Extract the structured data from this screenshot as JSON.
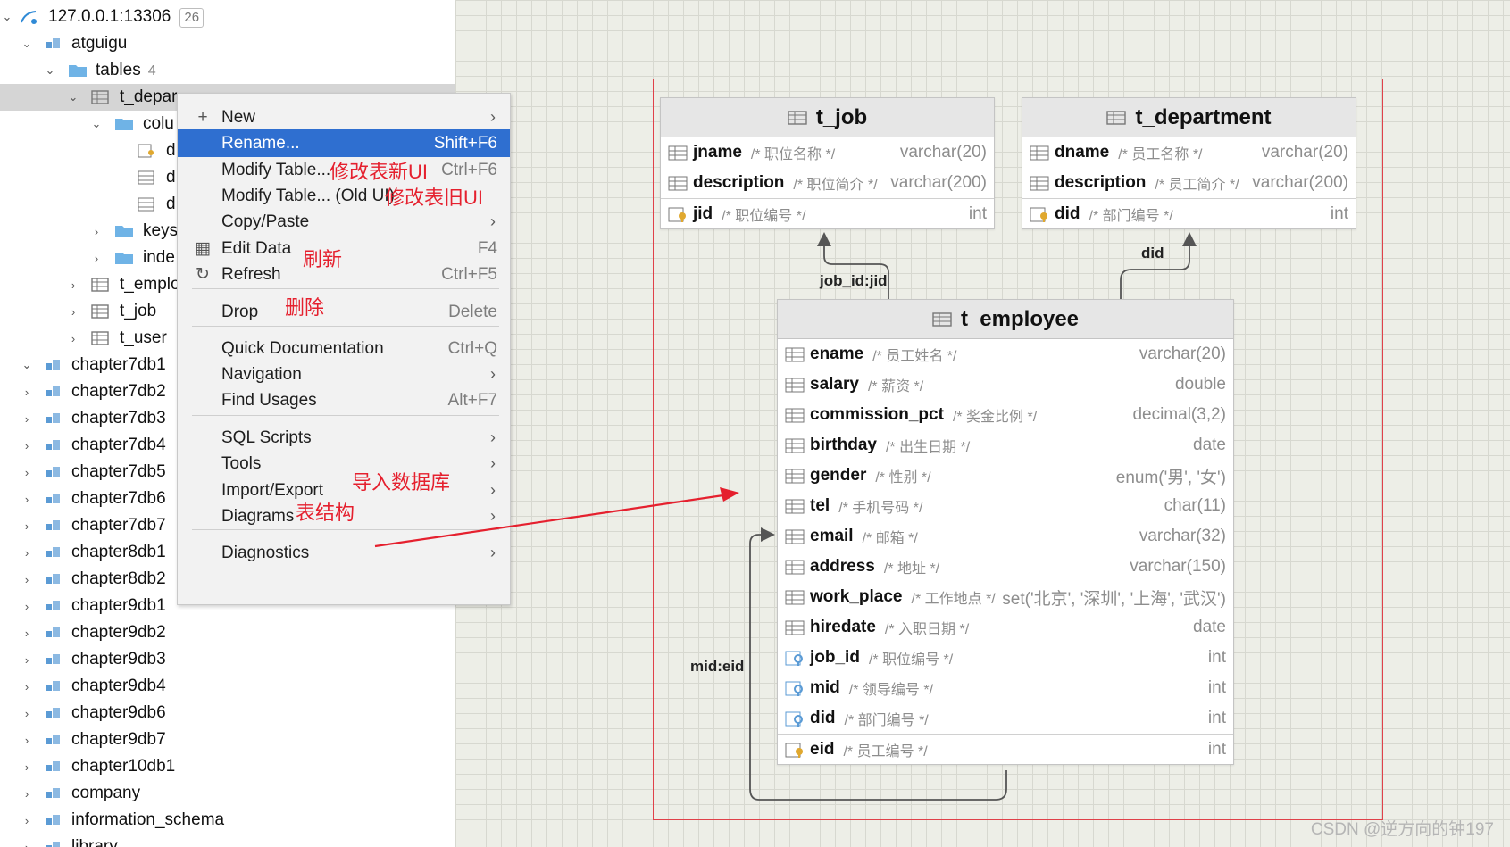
{
  "tree": {
    "connection": {
      "label": "127.0.0.1:13306",
      "badge": "26"
    },
    "schema": "atguigu",
    "tables_label": "tables",
    "tables_count": "4",
    "selected_table": "t_depar",
    "columns_label": "colu",
    "column_items": [
      "d",
      "d",
      "d"
    ],
    "keys_label": "keys",
    "indexes_label": "inde",
    "other_tables": [
      "t_emplo",
      "t_job",
      "t_user"
    ],
    "databases": [
      "chapter7db1",
      "chapter7db2",
      "chapter7db3",
      "chapter7db4",
      "chapter7db5",
      "chapter7db6",
      "chapter7db7",
      "chapter8db1",
      "chapter8db2",
      "chapter9db1",
      "chapter9db2",
      "chapter9db3",
      "chapter9db4",
      "chapter9db6",
      "chapter9db7",
      "chapter10db1",
      "company",
      "information_schema",
      "library"
    ]
  },
  "menu": {
    "items": [
      {
        "label": "New",
        "shortcut": "",
        "submenu": true
      },
      {
        "label": "Rename...",
        "shortcut": "Shift+F6",
        "submenu": false
      },
      {
        "label": "Modify Table...",
        "shortcut": "Ctrl+F6",
        "submenu": false
      },
      {
        "label": "Modify Table... (Old UI)",
        "shortcut": "",
        "submenu": false
      },
      {
        "label": "Copy/Paste",
        "shortcut": "",
        "submenu": true
      },
      {
        "label": "Edit Data",
        "shortcut": "F4",
        "submenu": false
      },
      {
        "label": "Refresh",
        "shortcut": "Ctrl+F5",
        "submenu": false
      },
      {
        "label": "Drop",
        "shortcut": "Delete",
        "submenu": false
      },
      {
        "label": "Quick Documentation",
        "shortcut": "Ctrl+Q",
        "submenu": false
      },
      {
        "label": "Navigation",
        "shortcut": "",
        "submenu": true
      },
      {
        "label": "Find Usages",
        "shortcut": "Alt+F7",
        "submenu": false
      },
      {
        "label": "SQL Scripts",
        "shortcut": "",
        "submenu": true
      },
      {
        "label": "Tools",
        "shortcut": "",
        "submenu": true
      },
      {
        "label": "Import/Export",
        "shortcut": "",
        "submenu": true
      },
      {
        "label": "Diagrams",
        "shortcut": "",
        "submenu": true
      },
      {
        "label": "Diagnostics",
        "shortcut": "",
        "submenu": true
      }
    ],
    "highlighted_index": 1,
    "annotations": {
      "modify_new": "修改表新UI",
      "modify_old": "修改表旧UI",
      "refresh": "刷新",
      "drop": "删除",
      "import": "导入数据库",
      "diagrams": "表结构"
    },
    "annotation_color": "#e5202e"
  },
  "diagram": {
    "t_job": {
      "title": "t_job",
      "fields": [
        {
          "name": "jname",
          "comment": "/* 职位名称 */",
          "type": "varchar(20)"
        },
        {
          "name": "description",
          "comment": "/* 职位简介 */",
          "type": "varchar(200)"
        }
      ],
      "key": {
        "name": "jid",
        "comment": "/* 职位编号 */",
        "type": "int"
      }
    },
    "t_department": {
      "title": "t_department",
      "fields": [
        {
          "name": "dname",
          "comment": "/* 员工名称 */",
          "type": "varchar(20)"
        },
        {
          "name": "description",
          "comment": "/* 员工简介 */",
          "type": "varchar(200)"
        }
      ],
      "key": {
        "name": "did",
        "comment": "/* 部门编号 */",
        "type": "int"
      }
    },
    "t_employee": {
      "title": "t_employee",
      "fields": [
        {
          "name": "ename",
          "comment": "/* 员工姓名 */",
          "type": "varchar(20)"
        },
        {
          "name": "salary",
          "comment": "/* 薪资 */",
          "type": "double"
        },
        {
          "name": "commission_pct",
          "comment": "/* 奖金比例 */",
          "type": "decimal(3,2)"
        },
        {
          "name": "birthday",
          "comment": "/* 出生日期 */",
          "type": "date"
        },
        {
          "name": "gender",
          "comment": "/* 性别 */",
          "type": "enum('男', '女')"
        },
        {
          "name": "tel",
          "comment": "/* 手机号码 */",
          "type": "char(11)"
        },
        {
          "name": "email",
          "comment": "/* 邮箱 */",
          "type": "varchar(32)"
        },
        {
          "name": "address",
          "comment": "/* 地址 */",
          "type": "varchar(150)"
        },
        {
          "name": "work_place",
          "comment": "/* 工作地点 */",
          "type": "set('北京', '深圳', '上海', '武汉')"
        },
        {
          "name": "hiredate",
          "comment": "/* 入职日期 */",
          "type": "date"
        },
        {
          "name": "job_id",
          "comment": "/* 职位编号 */",
          "type": "int"
        },
        {
          "name": "mid",
          "comment": "/* 领导编号 */",
          "type": "int"
        },
        {
          "name": "did",
          "comment": "/* 部门编号 */",
          "type": "int"
        }
      ],
      "key": {
        "name": "eid",
        "comment": "/* 员工编号 */",
        "type": "int"
      }
    },
    "relations": {
      "job": "job_id:jid",
      "dept": "did",
      "self": "mid:eid"
    },
    "frame_color": "#e0414a"
  },
  "watermark": "CSDN @逆方向的钟197"
}
